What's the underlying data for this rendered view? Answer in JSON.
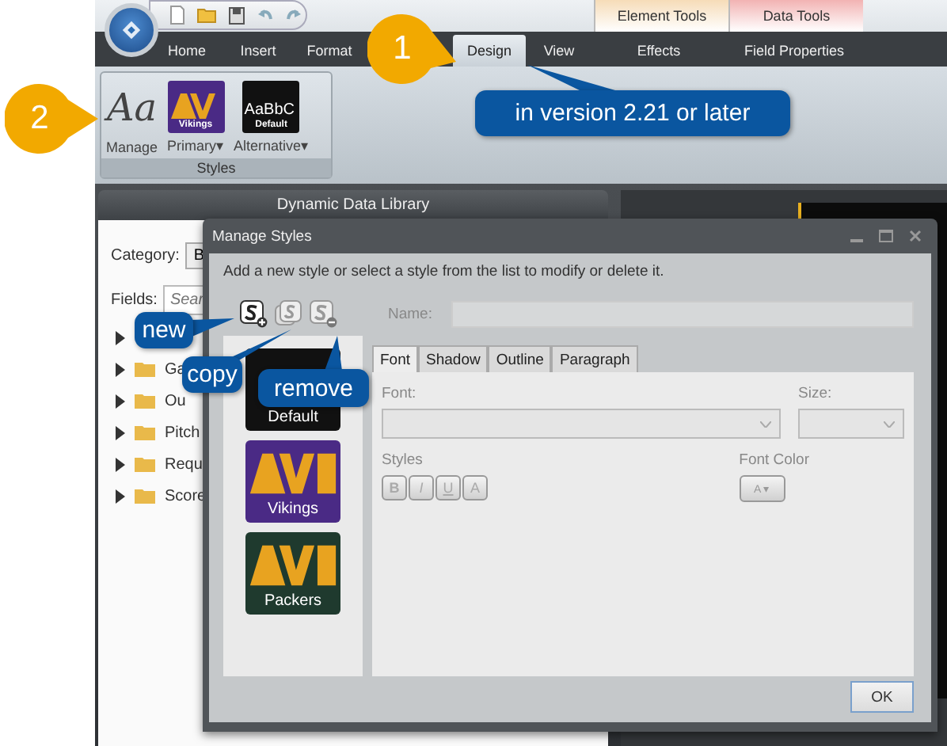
{
  "context_tabs": [
    {
      "label": "Element Tools",
      "color": "#f6dcb8"
    },
    {
      "label": "Data Tools",
      "color": "#f2b3b3"
    }
  ],
  "tabs": [
    {
      "label": "Home",
      "selected": false
    },
    {
      "label": "Insert",
      "selected": false
    },
    {
      "label": "Format",
      "selected": false
    },
    {
      "label": "Design",
      "selected": true
    },
    {
      "label": "View",
      "selected": false
    },
    {
      "label": "Effects",
      "selected": false
    },
    {
      "label": "Field Properties",
      "selected": false
    }
  ],
  "ribbon": {
    "group": "Styles",
    "items": [
      {
        "kind": "manage",
        "label": "Manage",
        "glyph": "Aa"
      },
      {
        "kind": "swatch",
        "label": "Primary",
        "color": "#4a2a85",
        "art": true,
        "caption": "Vikings",
        "caret": "▾"
      },
      {
        "kind": "swatch",
        "label": "Alternative",
        "color": "#111111",
        "art": false,
        "sample": "AaBbC",
        "caption": "Default",
        "caret": "▾"
      }
    ]
  },
  "library": {
    "title": "Dynamic Data Library",
    "category_label": "Category:",
    "category_value": "B",
    "fields_label": "Fields:",
    "search_placeholder": "Sear",
    "items": [
      {
        "folder": false
      },
      {
        "folder": true,
        "label": "Ga"
      },
      {
        "folder": true,
        "label": "Ou"
      },
      {
        "folder": true,
        "label": "Pitch"
      },
      {
        "folder": true,
        "label": "Requ"
      },
      {
        "folder": true,
        "label": "Score"
      }
    ]
  },
  "dialog": {
    "title": "Manage Styles",
    "instructions": "Add a new style or select a style from the list to modify or delete it.",
    "name_label": "Name:",
    "name_disabled": true,
    "styles": [
      {
        "caption": "Default",
        "color": "#111111",
        "art": false
      },
      {
        "caption": "Vikings",
        "color": "#4a2a85",
        "art": true
      },
      {
        "caption": "Packers",
        "color": "#1f3a2e",
        "art": true
      }
    ],
    "tabs": [
      {
        "label": "Font",
        "selected": true
      },
      {
        "label": "Shadow",
        "selected": false
      },
      {
        "label": "Outline",
        "selected": false
      },
      {
        "label": "Paragraph",
        "selected": false
      }
    ],
    "font_label": "Font:",
    "size_label": "Size:",
    "styles_label": "Styles",
    "format_buttons": [
      {
        "glyph": "B",
        "disabled": true
      },
      {
        "glyph": "I",
        "disabled": true
      },
      {
        "glyph": "U",
        "disabled": true
      },
      {
        "glyph": "A",
        "disabled": true
      }
    ],
    "font_color_label": "Font Color",
    "font_color_glyph": "A",
    "font_color_caret": "▾",
    "ok": "OK"
  },
  "callouts": [
    {
      "kind": "step",
      "text": "1"
    },
    {
      "kind": "step",
      "text": "2"
    },
    {
      "kind": "note",
      "text": "in version 2.21 or later"
    },
    {
      "kind": "note",
      "text": "new"
    },
    {
      "kind": "note",
      "text": "copy"
    },
    {
      "kind": "note",
      "text": "remove"
    }
  ]
}
